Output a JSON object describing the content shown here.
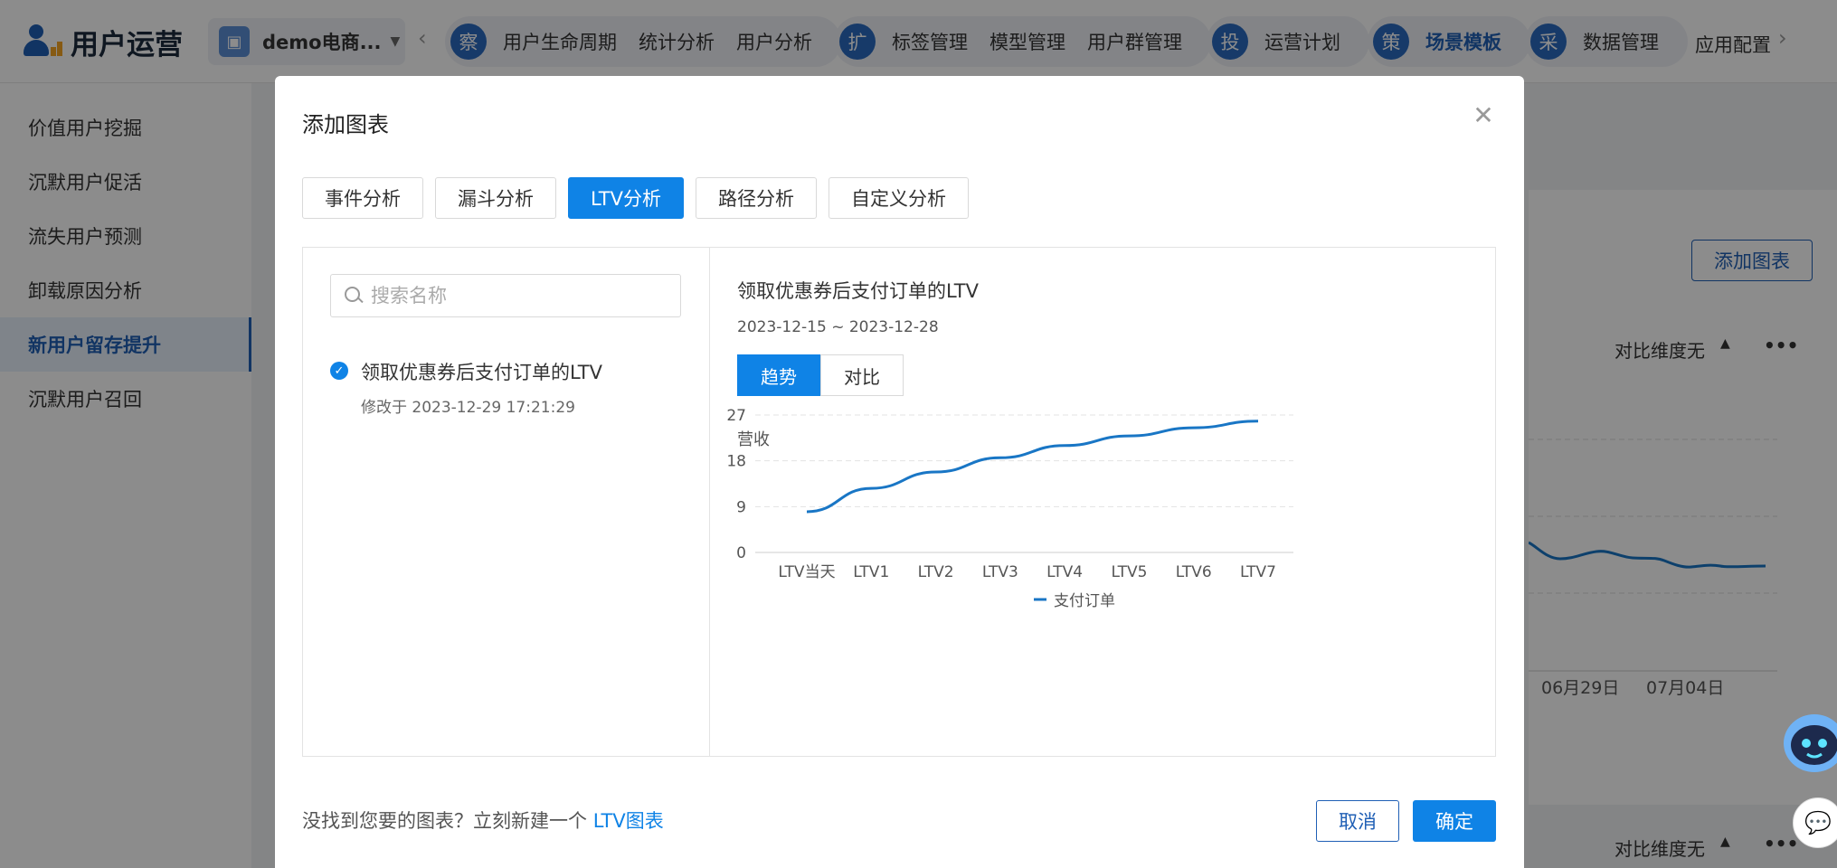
{
  "app": {
    "title": "用户运营",
    "project": "demo电商..."
  },
  "topnav": {
    "group1": {
      "badge": "察",
      "items": [
        "用户生命周期",
        "统计分析",
        "用户分析"
      ]
    },
    "group2": {
      "badge": "扩",
      "items": [
        "标签管理",
        "模型管理",
        "用户群管理"
      ]
    },
    "group3": {
      "badge": "投",
      "items": [
        "运营计划"
      ]
    },
    "group4": {
      "badge": "策",
      "items": [
        "场景模板"
      ]
    },
    "group5": {
      "badge": "采",
      "items": [
        "数据管理"
      ]
    },
    "tail": "应用配置"
  },
  "sidebar": {
    "items": [
      {
        "label": "价值用户挖掘"
      },
      {
        "label": "沉默用户促活"
      },
      {
        "label": "流失用户预测"
      },
      {
        "label": "卸载原因分析"
      },
      {
        "label": "新用户留存提升"
      },
      {
        "label": "沉默用户召回"
      }
    ],
    "active_index": 4
  },
  "background": {
    "add_chart": "添加图表",
    "compare_dim": "对比维度无",
    "more": "•••",
    "dates": [
      "06月29日",
      "07月04日"
    ]
  },
  "modal": {
    "title": "添加图表",
    "tabs": [
      "事件分析",
      "漏斗分析",
      "LTV分析",
      "路径分析",
      "自定义分析"
    ],
    "active_tab": 2,
    "search_placeholder": "搜索名称",
    "chart_item": {
      "name": "领取优惠券后支付订单的LTV",
      "modified": "修改于 2023-12-29 17:21:29"
    },
    "preview": {
      "title": "领取优惠券后支付订单的LTV",
      "range": "2023-12-15 ~ 2023-12-28",
      "seg": [
        "趋势",
        "对比"
      ],
      "ylabel": "营收",
      "legend": "支付订单"
    },
    "footer": {
      "prompt": "没找到您要的图表？立刻新建一个 ",
      "link": "LTV图表"
    },
    "cancel": "取消",
    "confirm": "确定"
  },
  "colors": {
    "accent": "#0f83e6",
    "brand": "#1f5fb5"
  },
  "chart_data": {
    "type": "line",
    "categories": [
      "LTV当天",
      "LTV1",
      "LTV2",
      "LTV3",
      "LTV4",
      "LTV5",
      "LTV6",
      "LTV7"
    ],
    "series": [
      {
        "name": "支付订单",
        "values": [
          8,
          12.6,
          15.8,
          18.6,
          21,
          22.9,
          24.5,
          25.8
        ]
      }
    ],
    "ylabel": "营收",
    "yticks": [
      0,
      9,
      18,
      27
    ],
    "ylim": [
      0,
      27
    ],
    "grid": true,
    "legend": "bottom-center"
  }
}
